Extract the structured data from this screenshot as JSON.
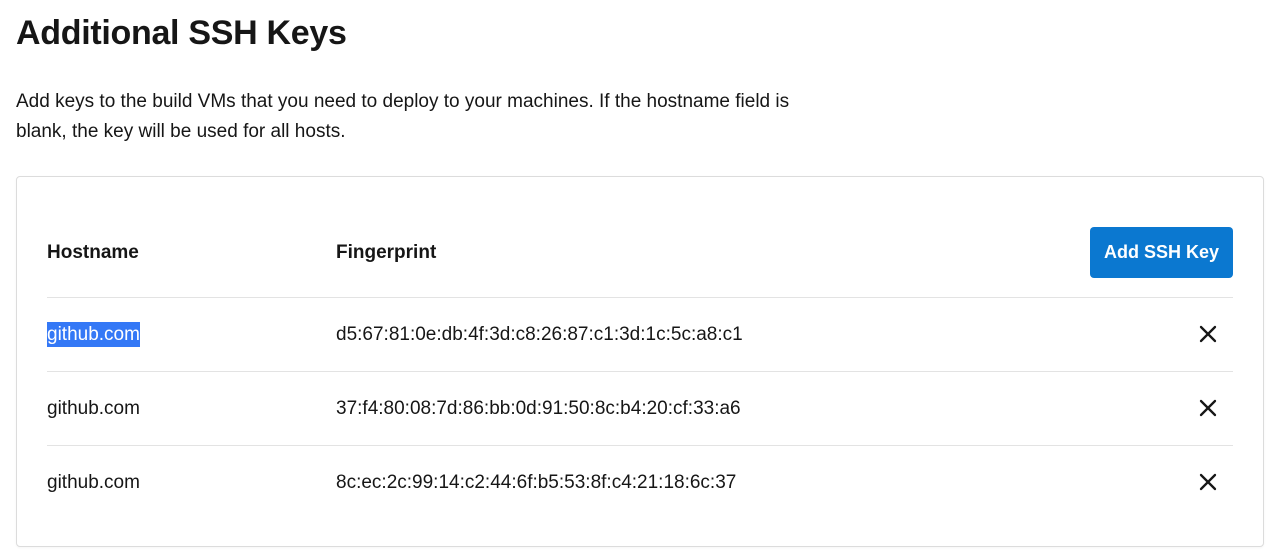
{
  "page": {
    "title": "Additional SSH Keys",
    "description": "Add keys to the build VMs that you need to deploy to your machines. If the hostname field is blank, the key will be used for all hosts."
  },
  "table": {
    "headers": {
      "hostname": "Hostname",
      "fingerprint": "Fingerprint"
    },
    "add_button_label": "Add SSH Key",
    "rows": [
      {
        "hostname": "github.com",
        "fingerprint": "d5:67:81:0e:db:4f:3d:c8:26:87:c1:3d:1c:5c:a8:c1",
        "selected": true,
        "delete_icon": "close-icon"
      },
      {
        "hostname": "github.com",
        "fingerprint": "37:f4:80:08:7d:86:bb:0d:91:50:8c:b4:20:cf:33:a6",
        "selected": false,
        "delete_icon": "close-icon"
      },
      {
        "hostname": "github.com",
        "fingerprint": "8c:ec:2c:99:14:c2:44:6f:b5:53:8f:c4:21:18:6c:37",
        "selected": false,
        "delete_icon": "close-icon"
      }
    ]
  },
  "colors": {
    "accent": "#0b78d0",
    "selection": "#3478f6",
    "text": "#161616",
    "border": "#dcdcdc"
  }
}
